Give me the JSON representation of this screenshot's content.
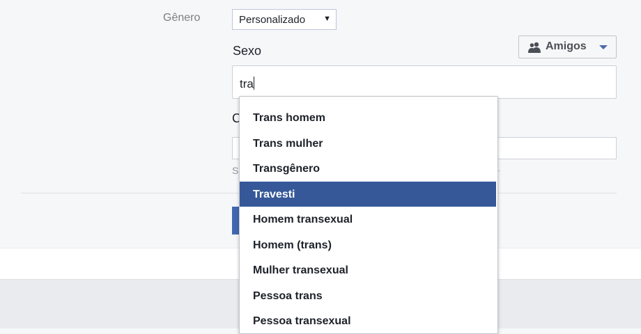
{
  "form": {
    "genero_label": "Gênero",
    "genero_value": "Personalizado",
    "sexo_label": "Sexo",
    "audience_button": "Amigos",
    "sexo_input_value": "tra",
    "hidden_label_fragment": "C",
    "hidden_help_fragment": "S"
  },
  "dropdown": {
    "selected_index": 3,
    "options": [
      "Trans homem",
      "Trans mulher",
      "Transgênero",
      "Travesti",
      "Homem transexual",
      "Homem (trans)",
      "Mulher transexual",
      "Pessoa trans",
      "Pessoa transexual"
    ]
  },
  "colors": {
    "highlight": "#365899",
    "primary_button": "#4267b2"
  }
}
